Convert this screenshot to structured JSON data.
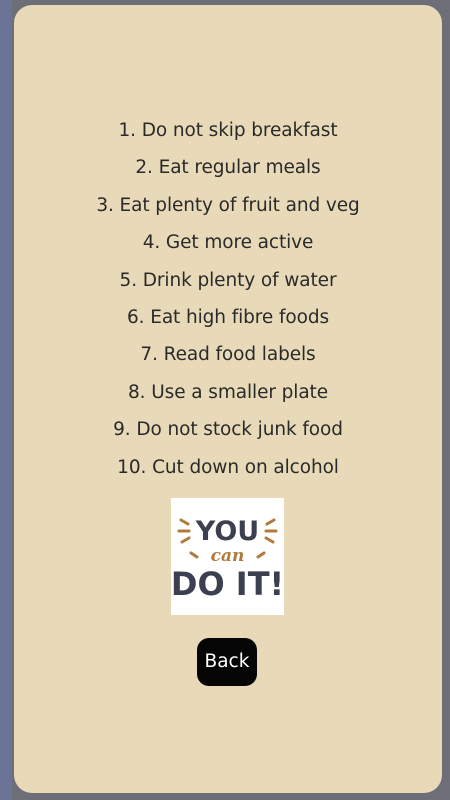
{
  "tips": [
    "1. Do not skip breakfast",
    "2. Eat regular meals",
    "3. Eat plenty of fruit and veg",
    "4. Get more active",
    "5. Drink plenty of water",
    "6. Eat high fibre foods",
    "7. Read food labels",
    "8. Use a smaller plate",
    "9. Do not stock junk food",
    "10. Cut down on alcohol"
  ],
  "badge": {
    "line1": "YOU",
    "line2": "can",
    "line3": "DO IT!",
    "colors": {
      "text": "#3b3f4f",
      "accent": "#b07a3a"
    }
  },
  "back_label": "Back"
}
